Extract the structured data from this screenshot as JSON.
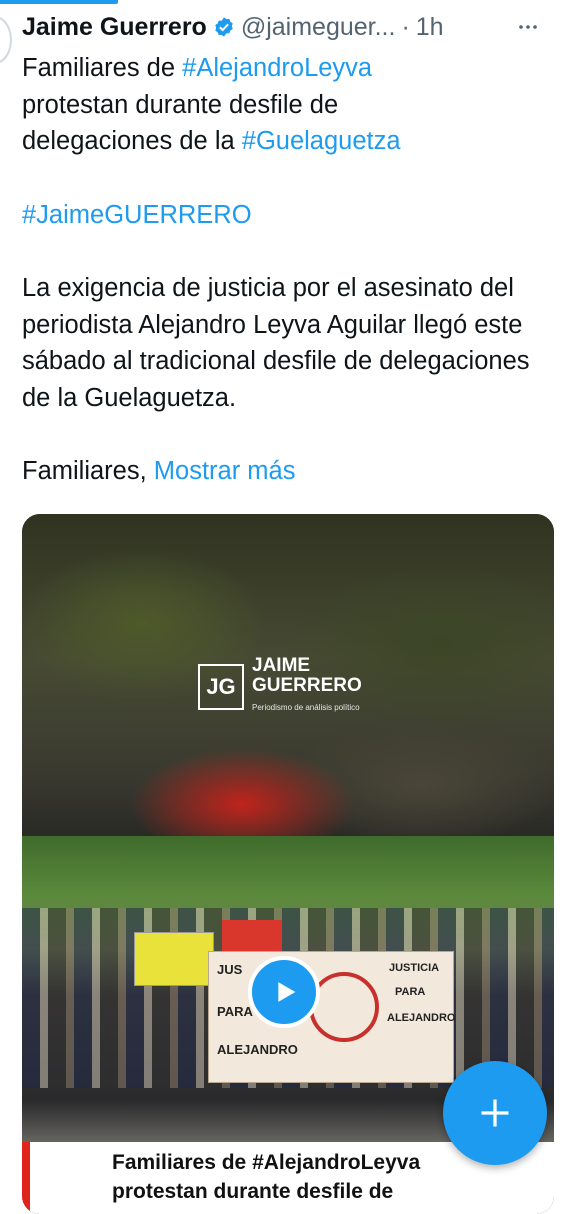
{
  "tweet": {
    "author": "Jaime Guerrero",
    "handle": "@jaimeguer...",
    "separator": "·",
    "time": "1h",
    "text": {
      "line1_prefix": "Familiares de ",
      "hashtag1": "#AlejandroLeyva",
      "line2": "protestan durante desfile de",
      "line3_prefix": "delegaciones de la ",
      "hashtag2": "#Guelaguetza",
      "hashtag3": "#JaimeGUERRERO",
      "paragraph": "La exigencia de justicia por el asesinato del periodista Alejandro Leyva Aguilar llegó este sábado al tradicional desfile de delegaciones de la Guelaguetza.",
      "tail_prefix": "Familiares, ",
      "show_more": "Mostrar más"
    }
  },
  "media": {
    "logo_mark": "JG",
    "logo_line1": "JAIME",
    "logo_line2": "GUERRERO",
    "logo_sub": "Periodismo de análisis político",
    "banner_left_1": "JUS",
    "banner_left_2": "PARA",
    "banner_left_3": "ALEJANDRO",
    "banner_right_1": "JUSTICIA",
    "banner_right_2": "PARA",
    "banner_right_3": "ALEJANDRO",
    "caption_line1": "Familiares de #AlejandroLeyva",
    "caption_line2": "protestan durante desfile de"
  },
  "colors": {
    "accent": "#1d9bf0",
    "caption_bar": "#e0241c"
  },
  "icons": {
    "verified": "verified-badge-icon",
    "more": "more-options-icon",
    "play": "play-icon",
    "compose": "compose-plus-icon"
  }
}
